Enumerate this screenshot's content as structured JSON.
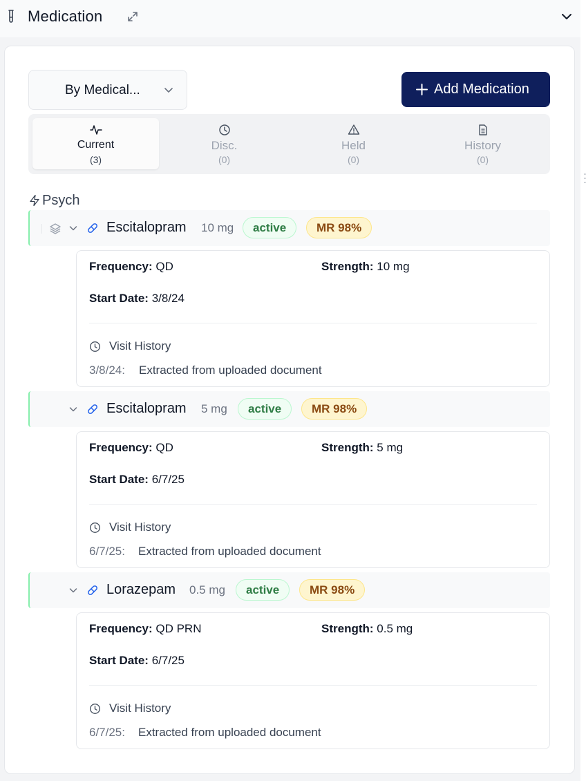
{
  "header": {
    "title": "Medication",
    "tube_icon": "test-tube-icon",
    "expand_icon": "expand-arrows-icon",
    "collapse_icon": "chevron-down-icon"
  },
  "toolbar": {
    "group_by_value": "By Medical...",
    "add_button_label": "Add Medication"
  },
  "tabs": [
    {
      "label": "Current",
      "count": "(3)",
      "icon": "activity-icon",
      "active": true
    },
    {
      "label": "Disc.",
      "count": "(0)",
      "icon": "clock-icon",
      "active": false
    },
    {
      "label": "Held",
      "count": "(0)",
      "icon": "warning-triangle-icon",
      "active": false
    },
    {
      "label": "History",
      "count": "(0)",
      "icon": "document-icon",
      "active": false
    }
  ],
  "section": {
    "name": "Psych",
    "icon": "lightning-icon"
  },
  "medications": [
    {
      "name": "Escitalopram",
      "dose": "10 mg",
      "status": "active",
      "mr": "MR 98%",
      "frequency_label": "Frequency:",
      "frequency": "QD",
      "strength_label": "Strength:",
      "strength": "10 mg",
      "start_label": "Start Date:",
      "start_date": "3/8/24",
      "visit_history_label": "Visit History",
      "history": {
        "date": "3/8/24:",
        "note": "Extracted from uploaded document"
      }
    },
    {
      "name": "Escitalopram",
      "dose": "5 mg",
      "status": "active",
      "mr": "MR 98%",
      "frequency_label": "Frequency:",
      "frequency": "QD",
      "strength_label": "Strength:",
      "strength": "5 mg",
      "start_label": "Start Date:",
      "start_date": "6/7/25",
      "visit_history_label": "Visit History",
      "history": {
        "date": "6/7/25:",
        "note": "Extracted from uploaded document"
      }
    },
    {
      "name": "Lorazepam",
      "dose": "0.5 mg",
      "status": "active",
      "mr": "MR 98%",
      "frequency_label": "Frequency:",
      "frequency": "QD PRN",
      "strength_label": "Strength:",
      "strength": "0.5 mg",
      "start_label": "Start Date:",
      "start_date": "6/7/25",
      "visit_history_label": "Visit History",
      "history": {
        "date": "6/7/25:",
        "note": "Extracted from uploaded document"
      }
    }
  ]
}
